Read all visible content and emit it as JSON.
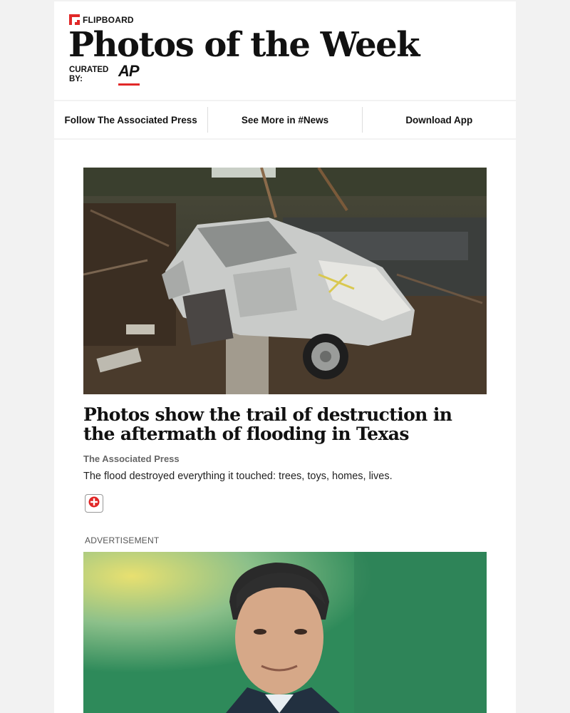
{
  "brand": {
    "name": "FLIPBOARD",
    "accent": "#e12828"
  },
  "header": {
    "title": "Photos of the Week",
    "curated_label": "CURATED BY:",
    "curator_logo": "AP"
  },
  "nav": {
    "items": [
      {
        "label": "Follow The Associated Press"
      },
      {
        "label": "See More in #News"
      },
      {
        "label": "Download App"
      }
    ]
  },
  "article": {
    "image_alt": "Destroyed car amid flood debris",
    "headline": "Photos show the trail of destruction in the aftermath of flooding in Texas",
    "source": "The Associated Press",
    "description": "The flood destroyed everything it touched: trees, toys, homes, lives.",
    "add_icon": "plus-icon"
  },
  "ad": {
    "label": "ADVERTISEMENT",
    "image_alt": "Portrait of a man in a suit on green background"
  }
}
